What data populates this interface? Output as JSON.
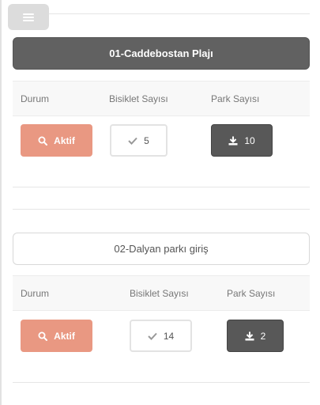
{
  "stations": [
    {
      "title": "01-Caddebostan Plajı",
      "headers": {
        "status": "Durum",
        "bikes": "Bisiklet Sayısı",
        "parks": "Park Sayısı"
      },
      "status": "Aktif",
      "bike_count": "5",
      "park_count": "10"
    },
    {
      "title": "02-Dalyan parkı giriş",
      "headers": {
        "status": "Durum",
        "bikes": "Bisiklet Sayısı",
        "parks": "Park Sayısı"
      },
      "status": "Aktif",
      "bike_count": "14",
      "park_count": "2"
    }
  ],
  "icons": {
    "menu": "hamburger-icon",
    "status": "search-icon",
    "bikes": "check-icon",
    "parks": "download-icon"
  },
  "colors": {
    "active_button": "#e99882",
    "title_dark": "#616161",
    "park_button": "#585858"
  }
}
